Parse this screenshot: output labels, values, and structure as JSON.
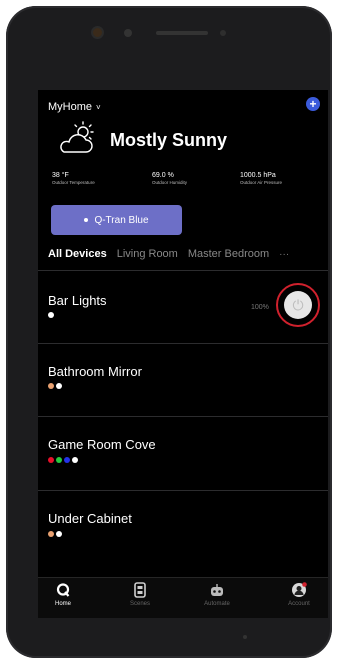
{
  "header": {
    "home_label": "MyHome",
    "chevron": "˅",
    "add_icon": "plus-icon",
    "add_glyph": "+"
  },
  "weather": {
    "condition": "Mostly Sunny",
    "icon": "partly-sunny-icon",
    "stats": [
      {
        "value": "38 °F",
        "label": "Outdoor Temperature"
      },
      {
        "value": "69.0 %",
        "label": "Outdoor Humidity"
      },
      {
        "value": "1000.5 hPa",
        "label": "Outdoor Air Pressure"
      }
    ]
  },
  "scene": {
    "label": "Q-Tran Blue"
  },
  "tabs": {
    "items": [
      "All Devices",
      "Living Room",
      "Master Bedroom"
    ],
    "active": "All Devices",
    "more": "···"
  },
  "devices": [
    {
      "name": "Bar Lights",
      "colors": [
        "#ffffff"
      ],
      "percent": "100%"
    },
    {
      "name": "Bathroom Mirror",
      "colors": [
        "#e8a070",
        "#ffffff"
      ]
    },
    {
      "name": "Game Room Cove",
      "colors": [
        "#e8102a",
        "#27c93f",
        "#2433e8",
        "#ffffff"
      ]
    },
    {
      "name": "Under Cabinet",
      "colors": [
        "#e8a070",
        "#ffffff"
      ]
    }
  ],
  "power": {
    "icon": "power-icon",
    "glyph": "⏻",
    "ring_color": "#d0212d"
  },
  "nav": {
    "items": [
      {
        "label": "Home",
        "icon": "home-q-icon"
      },
      {
        "label": "Scenes",
        "icon": "scenes-icon"
      },
      {
        "label": "Automate",
        "icon": "robot-icon"
      },
      {
        "label": "Account",
        "icon": "account-icon"
      }
    ],
    "active": "Home"
  },
  "colors": {
    "accent": "#6d6fc7",
    "add_button": "#3b5bdb",
    "background": "#000000"
  }
}
